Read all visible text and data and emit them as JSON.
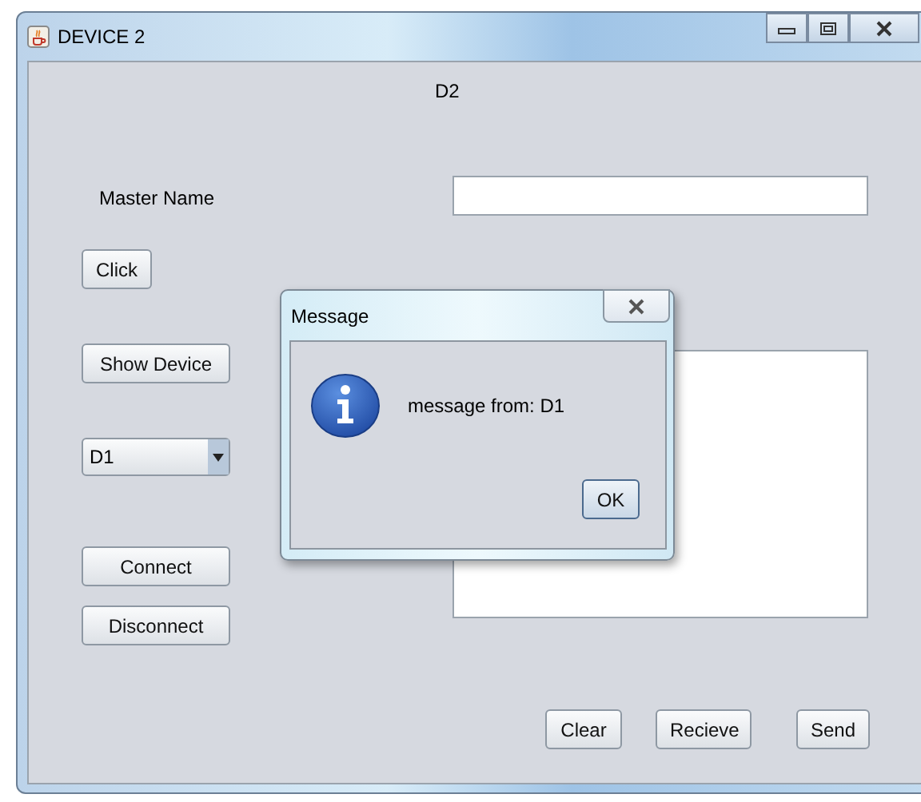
{
  "window": {
    "title": "DEVICE 2"
  },
  "heading": "D2",
  "master_name": {
    "label": "Master Name"
  },
  "left_buttons": [
    "Click",
    "Show Device"
  ],
  "device_select": {
    "value": "D1"
  },
  "connection_buttons": [
    "Connect",
    "Disconnect"
  ],
  "bottom_buttons": [
    "Clear",
    "Recieve",
    "Send"
  ],
  "dialog": {
    "title": "Message",
    "message": "message from: D1",
    "button": "OK"
  }
}
